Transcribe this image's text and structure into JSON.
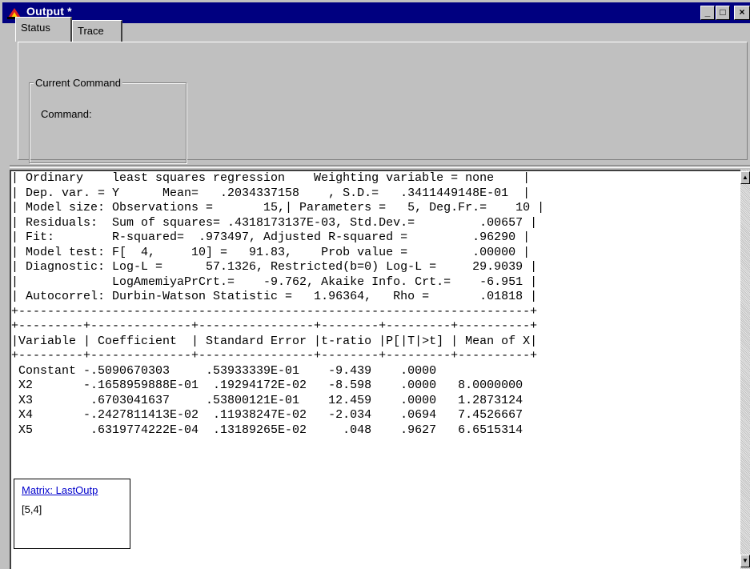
{
  "window": {
    "title": "Output *",
    "minimize_label": "_",
    "maximize_label": "□",
    "close_label": "×"
  },
  "tabs": [
    {
      "label": "Status"
    },
    {
      "label": "Trace"
    }
  ],
  "status_panel": {
    "group_label": "Current Command",
    "command_label": "Command:"
  },
  "output": {
    "lines": [
      "| Ordinary    least squares regression    Weighting variable = none    |",
      "| Dep. var. = Y      Mean=   .2034337158    , S.D.=   .3411449148E-01  |",
      "| Model size: Observations =       15,| Parameters =   5, Deg.Fr.=    10 |",
      "| Residuals:  Sum of squares= .4318173137E-03, Std.Dev.=         .00657 |",
      "| Fit:        R-squared=  .973497, Adjusted R-squared =         .96290 |",
      "| Model test: F[  4,     10] =   91.83,    Prob value =         .00000 |",
      "| Diagnostic: Log-L =      57.1326, Restricted(b=0) Log-L =     29.9039 |",
      "|             LogAmemiyaPrCrt.=    -9.762, Akaike Info. Crt.=    -6.951 |",
      "| Autocorrel: Durbin-Watson Statistic =   1.96364,   Rho =       .01818 |",
      "+-----------------------------------------------------------------------+",
      "+---------+--------------+----------------+--------+---------+----------+",
      "|Variable | Coefficient  | Standard Error |t-ratio |P[|T|>t] | Mean of X|",
      "+---------+--------------+----------------+--------+---------+----------+",
      " Constant -.5090670303     .53933339E-01    -9.439    .0000",
      " X2       -.1658959888E-01  .19294172E-02   -8.598    .0000   8.0000000",
      " X3        .6703041637     .53800121E-01    12.459    .0000   1.2873124",
      " X4       -.2427811413E-02  .11938247E-02   -2.034    .0694   7.4526667",
      " X5        .6319774222E-04  .13189265E-02     .048    .9627   6.6515314"
    ]
  },
  "matrix": {
    "link_label": "Matrix: LastOutp",
    "dimension": "[5,4]"
  }
}
